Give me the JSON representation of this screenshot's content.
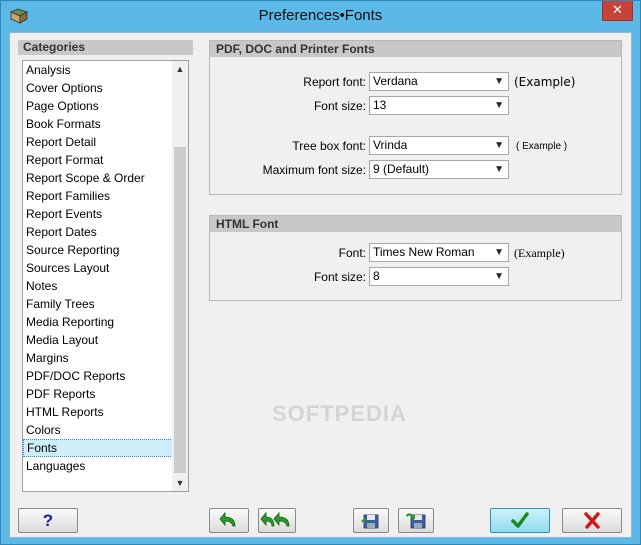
{
  "window": {
    "title": "Preferences•Fonts",
    "close_label": "✕"
  },
  "categories": {
    "header": "Categories",
    "items": [
      "Analysis",
      "Cover Options",
      "Page Options",
      "Book Formats",
      "Report Detail",
      "Report Format",
      "Report Scope & Order",
      "Report Families",
      "Report Events",
      "Report Dates",
      "Source Reporting",
      "Sources Layout",
      "Notes",
      "Family Trees",
      "Media Reporting",
      "Media Layout",
      "Margins",
      "PDF/DOC Reports",
      "PDF Reports",
      "HTML Reports",
      "Colors",
      "Fonts",
      "Languages"
    ],
    "selected": "Fonts"
  },
  "pdf_group": {
    "title": "PDF, DOC and Printer Fonts",
    "report_font_label": "Report font:",
    "report_font_value": "Verdana",
    "report_font_example": "(Example)",
    "font_size_label": "Font size:",
    "font_size_value": "13",
    "tree_font_label": "Tree box font:",
    "tree_font_value": "Vrinda",
    "tree_font_example": "( Example )",
    "max_size_label": "Maximum font size:",
    "max_size_value": "9 (Default)"
  },
  "html_group": {
    "title": "HTML Font",
    "font_label": "Font:",
    "font_value": "Times New Roman",
    "font_example": "(Example)",
    "font_size_label": "Font size:",
    "font_size_value": "8"
  },
  "buttons": {
    "help_label": "?"
  },
  "watermark": "SOFTPEDIA",
  "colors": {
    "titlebar": "#5cb8e6",
    "ok_button": "#8fdcee",
    "selected_item": "#cdeefa"
  }
}
